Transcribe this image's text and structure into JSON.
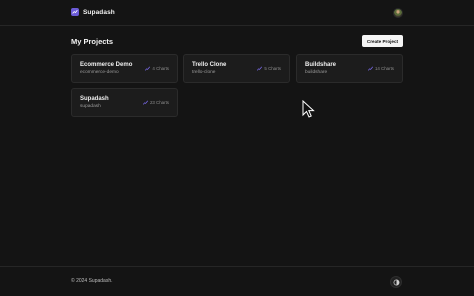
{
  "header": {
    "brand_name": "Supadash",
    "logo_icon": "chart-logo-icon",
    "avatar_icon": "user-avatar"
  },
  "main": {
    "title": "My Projects",
    "create_button_label": "Create Project",
    "projects": [
      {
        "name": "Ecommerce Demo",
        "slug": "ecommerce-demo",
        "charts": "4 Charts"
      },
      {
        "name": "Trello Clone",
        "slug": "trello-clone",
        "charts": "5 Charts"
      },
      {
        "name": "Buildshare",
        "slug": "buildshare",
        "charts": "14 Charts"
      },
      {
        "name": "Supadash",
        "slug": "supadash",
        "charts": "23 Charts"
      }
    ]
  },
  "footer": {
    "copyright": "© 2024 Supadash.",
    "theme_icon": "theme-toggle-icon"
  },
  "colors": {
    "background": "#141414",
    "card": "#1c1c1c",
    "accent": "#6b5bd6",
    "chart_icon": "#7c6cf0"
  }
}
